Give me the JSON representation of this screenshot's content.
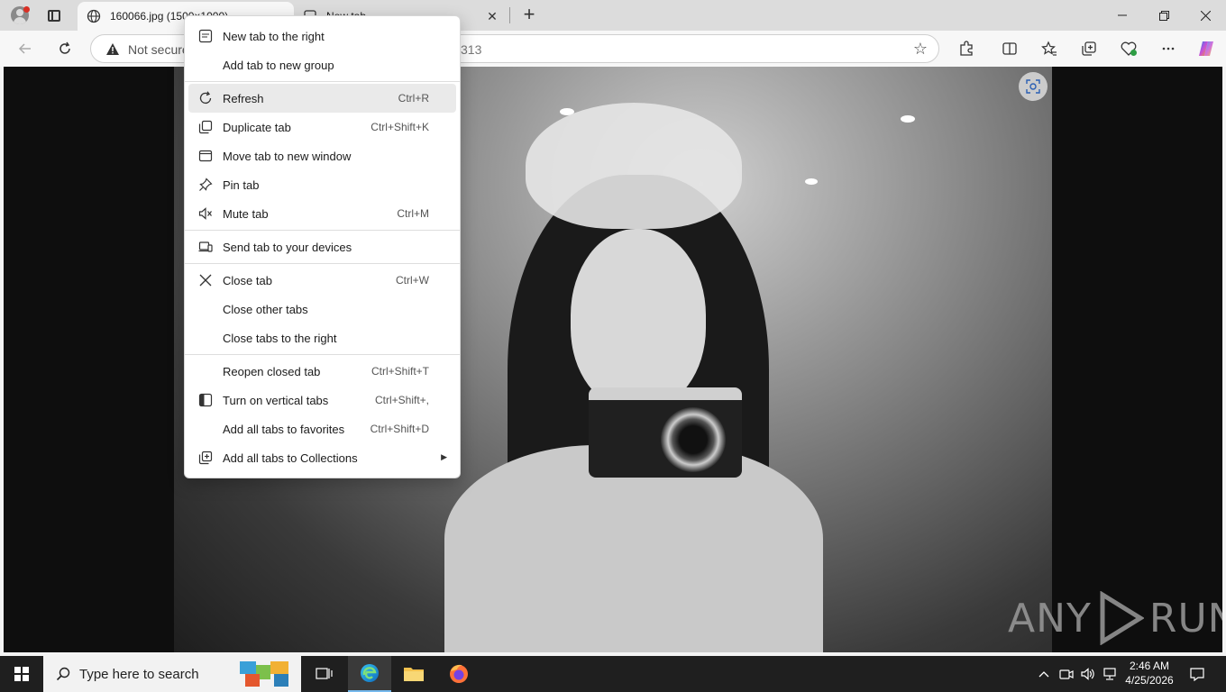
{
  "tabs": [
    {
      "title": "160066.jpg (1500×1000)",
      "active": true
    },
    {
      "title": "New tab",
      "active": false
    }
  ],
  "address": {
    "security_label": "Not secure",
    "url_fragment": "313"
  },
  "context_menu": {
    "items": [
      {
        "label": "New tab to the right",
        "shortcut": "",
        "icon": "new-tab-icon"
      },
      {
        "label": "Add tab to new group",
        "shortcut": "",
        "icon": ""
      },
      {
        "label": "Refresh",
        "shortcut": "Ctrl+R",
        "icon": "refresh-icon"
      },
      {
        "label": "Duplicate tab",
        "shortcut": "Ctrl+Shift+K",
        "icon": "duplicate-icon"
      },
      {
        "label": "Move tab to new window",
        "shortcut": "",
        "icon": "window-icon"
      },
      {
        "label": "Pin tab",
        "shortcut": "",
        "icon": "pin-icon"
      },
      {
        "label": "Mute tab",
        "shortcut": "Ctrl+M",
        "icon": "mute-icon"
      },
      {
        "label": "Send tab to your devices",
        "shortcut": "",
        "icon": "devices-icon"
      },
      {
        "label": "Close tab",
        "shortcut": "Ctrl+W",
        "icon": "close-icon"
      },
      {
        "label": "Close other tabs",
        "shortcut": "",
        "icon": ""
      },
      {
        "label": "Close tabs to the right",
        "shortcut": "",
        "icon": ""
      },
      {
        "label": "Reopen closed tab",
        "shortcut": "Ctrl+Shift+T",
        "icon": ""
      },
      {
        "label": "Turn on vertical tabs",
        "shortcut": "Ctrl+Shift+,",
        "icon": "vertical-tabs-icon"
      },
      {
        "label": "Add all tabs to favorites",
        "shortcut": "Ctrl+Shift+D",
        "icon": ""
      },
      {
        "label": "Add all tabs to Collections",
        "shortcut": "",
        "icon": "collections-add-icon"
      }
    ]
  },
  "watermark": {
    "text_left": "ANY",
    "text_right": "RUN"
  },
  "taskbar": {
    "search_placeholder": "Type here to search",
    "time": "2:46 AM",
    "date": "4/25/2026"
  },
  "colors": {
    "accent": "#0078d4",
    "taskbar_bg": "#1f1f1f",
    "menu_highlight": "#eaeaea"
  }
}
